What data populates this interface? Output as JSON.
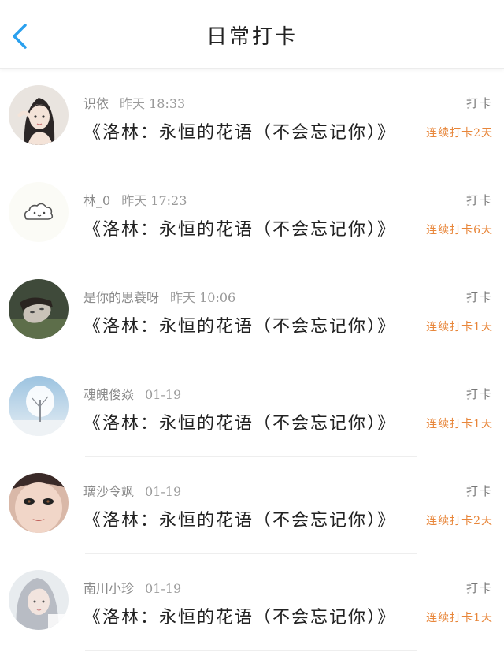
{
  "header": {
    "title": "日常打卡",
    "back_icon": "chevron-left-icon",
    "accent_color": "#2aa0ee"
  },
  "entries": [
    {
      "name": "识依",
      "time": "昨天 18:33",
      "content": "《洛林：永恒的花语（不会忘记你）》",
      "checkin": "打卡",
      "streak": "连续打卡2天",
      "avatar": "girl-illustration-avatar"
    },
    {
      "name": "林_0",
      "time": "昨天 17:23",
      "content": "《洛林：永恒的花语（不会忘记你）》",
      "checkin": "打卡",
      "streak": "连续打卡6天",
      "avatar": "cloud-avatar"
    },
    {
      "name": "是你的思蓑呀",
      "time": "昨天 10:06",
      "content": "《洛林：永恒的花语（不会忘记你）》",
      "checkin": "打卡",
      "streak": "连续打卡1天",
      "avatar": "portrait-photo-avatar"
    },
    {
      "name": "魂魄俊焱",
      "time": "01-19",
      "content": "《洛林：永恒的花语（不会忘记你）》",
      "checkin": "打卡",
      "streak": "连续打卡1天",
      "avatar": "snowy-tree-avatar"
    },
    {
      "name": "璃沙令飒",
      "time": "01-19",
      "content": "《洛林：永恒的花语（不会忘记你）》",
      "checkin": "打卡",
      "streak": "连续打卡2天",
      "avatar": "face-closeup-avatar"
    },
    {
      "name": "南川小珍",
      "time": "01-19",
      "content": "《洛林：永恒的花语（不会忘记你）》",
      "checkin": "打卡",
      "streak": "连续打卡1天",
      "avatar": "grey-hair-girl-avatar"
    }
  ]
}
